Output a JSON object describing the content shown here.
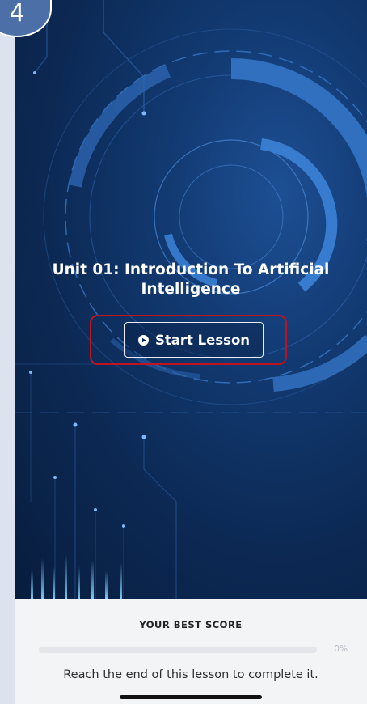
{
  "step": {
    "number": "4"
  },
  "lesson": {
    "title": "Unit 01: Introduction To Artificial Intelligence",
    "start_button_label": "Start Lesson",
    "play_icon": "play-circle-icon"
  },
  "score": {
    "title": "YOUR BEST SCORE",
    "progress_percent": 0,
    "progress_label": "0%",
    "hint": "Reach the end of this lesson to complete it."
  },
  "colors": {
    "highlight": "#c1121f",
    "hero_dark": "#081d3e",
    "hero_accent": "#2f6fc1",
    "badge": "#4c6fa8"
  }
}
